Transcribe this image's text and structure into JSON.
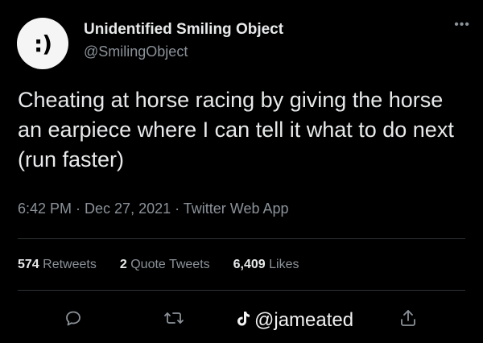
{
  "author": {
    "avatar_text": ":)",
    "display_name": "Unidentified Smiling Object",
    "handle": "@SmilingObject"
  },
  "tweet": {
    "text": "Cheating at horse racing by giving the horse an earpiece where I can tell it what to do next (run faster)",
    "meta": "6:42 PM · Dec 27, 2021 · Twitter Web App"
  },
  "stats": {
    "retweets_count": "574",
    "retweets_label": "Retweets",
    "quotes_count": "2",
    "quotes_label": "Quote Tweets",
    "likes_count": "6,409",
    "likes_label": "Likes"
  },
  "actions": [
    "reply-icon",
    "retweet-icon",
    "like-icon",
    "share-icon"
  ],
  "watermark": {
    "text": "@jameated"
  },
  "colors": {
    "background": "#000000",
    "text": "#e7e9ea",
    "muted": "#8b9299",
    "divider": "#2f3336"
  }
}
